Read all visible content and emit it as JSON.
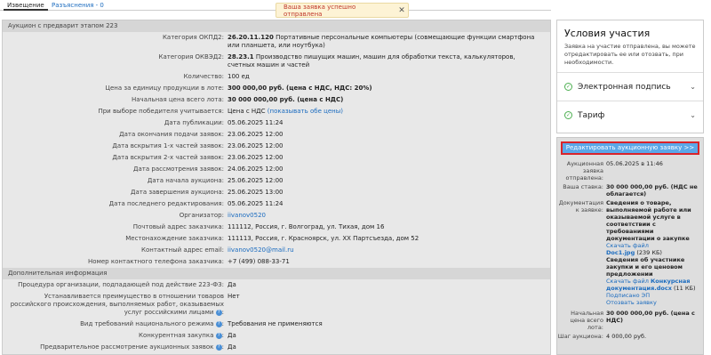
{
  "tabs": [
    {
      "label": "Извещение"
    },
    {
      "label": "Разъяснения - 0"
    }
  ],
  "toast": {
    "message": "Ваша заявка успешно отправлена"
  },
  "main": {
    "section1_title": "Аукцион с предварит этапом 223",
    "rows": [
      {
        "label": "Категория ОКПД2:",
        "val_bold": "26.20.11.120",
        "val": "Портативные персональные компьютеры (совмещающие функции смартфона или планшета, или ноутбука)"
      },
      {
        "label": "Категория ОКВЭД2:",
        "val_bold": "28.23.1",
        "val": "Производство пишущих машин, машин для обработки текста, калькуляторов, счетных машин и частей"
      },
      {
        "label": "Количество:",
        "val_bold": "",
        "val": "100 ед"
      },
      {
        "label": "Цена за единицу продукции в лоте:",
        "val_bold": "300 000,00 руб. (цена с НДС, НДС: 20%)",
        "val": ""
      },
      {
        "label": "Начальная цена всего лота:",
        "val_bold": "30 000 000,00 руб. (цена с НДС)",
        "val": ""
      },
      {
        "label": "При выборе победителя учитывается:",
        "val_bold": "",
        "val": "Цена с НДС",
        "link": "(показывать обе цены)"
      },
      {
        "label": "Дата публикации:",
        "val_bold": "",
        "val": "05.06.2025 11:24"
      },
      {
        "label": "Дата окончания подачи заявок:",
        "val_bold": "",
        "val": "23.06.2025 12:00"
      },
      {
        "label": "Дата вскрытия 1-х частей заявок:",
        "val_bold": "",
        "val": "23.06.2025 12:00"
      },
      {
        "label": "Дата вскрытия 2-х частей заявок:",
        "val_bold": "",
        "val": "23.06.2025 12:00"
      },
      {
        "label": "Дата рассмотрения заявок:",
        "val_bold": "",
        "val": "24.06.2025 12:00"
      },
      {
        "label": "Дата начала аукциона:",
        "val_bold": "",
        "val": "25.06.2025 12:00"
      },
      {
        "label": "Дата завершения аукциона:",
        "val_bold": "",
        "val": "25.06.2025 13:00"
      },
      {
        "label": "Дата последнего редактирования:",
        "val_bold": "",
        "val": "05.06.2025 11:24"
      },
      {
        "label": "Организатор:",
        "val_bold": "",
        "val": "",
        "link": "iivanov0520"
      },
      {
        "label": "Почтовый адрес заказчика:",
        "val_bold": "",
        "val": "111112, Россия, г. Волгоград, ул. Тихая, дом 16"
      },
      {
        "label": "Местонахождение заказчика:",
        "val_bold": "",
        "val": "111113, Россия, г. Красноярск, ул. ХХ Партсъезда, дом 52"
      },
      {
        "label": "Контактный адрес email:",
        "val_bold": "",
        "val": "",
        "link": "iivanov0520@mail.ru"
      },
      {
        "label": "Номер контактного телефона заказчика:",
        "val_bold": "",
        "val": "+7 (499) 088-33-71"
      }
    ],
    "section2_title": "Дополнительная информация",
    "rows2": [
      {
        "label": "Процедура организации, подпадающей под действие 223-ФЗ:",
        "val": "Да"
      },
      {
        "label": "Устанавливается преимущество в отношении товаров российского происхождения, выполняемых работ, оказываемых услуг российскими лицами",
        "val": "Нет"
      },
      {
        "label": "Вид требований национального режима",
        "val": "Требования не применяются"
      },
      {
        "label": "Конкурентная закупка",
        "val": "Да"
      },
      {
        "label": "Предварительное рассмотрение аукционных заявок",
        "val": "Да"
      }
    ]
  },
  "side": {
    "title": "Условия участия",
    "desc": "Заявка на участие отправлена, вы можете отредактировать ее или отозвать, при необходимости.",
    "acc1": "Электронная подпись",
    "acc2": "Тариф"
  },
  "application": {
    "edit_button": "Редактировать аукционную заявку >>",
    "sent_label": "Аукционная заявка отправлена:",
    "sent_value": "05.06.2025 в 11:46",
    "bid_label": "Ваша ставка:",
    "bid_value": "30 000 000,00 руб. (НДС не облагается)",
    "docs_label": "Документация к заявке:",
    "doc1_desc": "Сведения о товаре, выполняемой работе или оказываемой услуге в соответствии с требованиями документации о закупке",
    "doc1_link": "Скачать файл",
    "doc1_name": "Doc1.jpg",
    "doc1_size": "(239 КБ)",
    "doc2_desc": "Сведения об участнике закупки и его ценовом предложении",
    "doc2_link": "Скачать файл",
    "doc2_name": "Конкурсная документация.docx",
    "doc2_size": "(11 КБ)",
    "signed": "Подписано ЭП",
    "withdraw": "Отозвать заявку",
    "start_price_label": "Начальная цена всего лота:",
    "start_price_value": "30 000 000,00 руб. (цена с НДС)",
    "step_label": "Шаг аукциона:",
    "step_value": "4 000,00 руб."
  }
}
